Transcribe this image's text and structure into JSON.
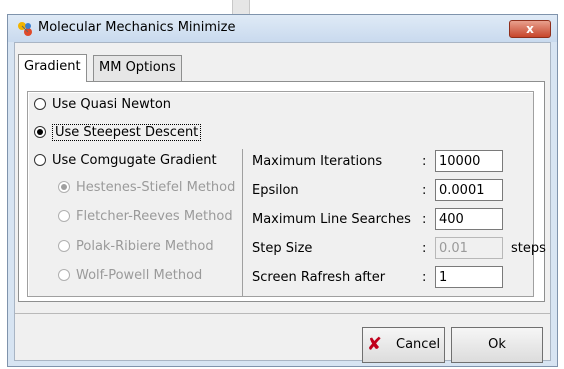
{
  "window": {
    "title": "Molecular Mechanics Minimize",
    "close_label": "x"
  },
  "tabs": [
    {
      "label": "Gradient",
      "active": true
    },
    {
      "label": "MM Options",
      "active": false
    }
  ],
  "methods": {
    "quasi_newton": "Use Quasi Newton",
    "steepest_descent": "Use Steepest Descent",
    "conjugate_gradient": "Use Comgugate Gradient"
  },
  "sub_methods": [
    "Hestenes-Stiefel Method",
    "Fletcher-Reeves Method",
    "Polak-Ribiere Method",
    "Wolf-Powell Method"
  ],
  "fields": {
    "max_iterations": {
      "label": "Maximum Iterations",
      "value": "10000"
    },
    "epsilon": {
      "label": "Epsilon",
      "value": "0.0001"
    },
    "max_line_searches": {
      "label": "Maximum Line Searches",
      "value": "400"
    },
    "step_size": {
      "label": "Step Size",
      "value": "0.01",
      "unit": "steps"
    },
    "screen_refresh": {
      "label": "Screen Rafresh after",
      "value": "1"
    }
  },
  "colon": ":",
  "buttons": {
    "cancel": "Cancel",
    "ok": "Ok"
  },
  "icons": {
    "app": "molecule-icon",
    "cancel": "x-icon"
  }
}
